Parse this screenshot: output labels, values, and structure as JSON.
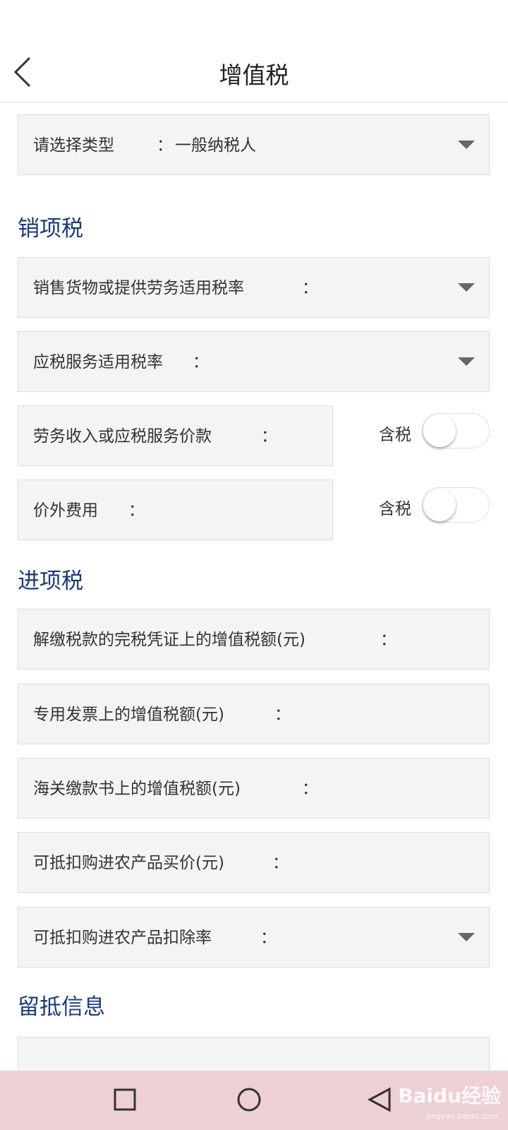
{
  "header": {
    "title": "增值税"
  },
  "type_select": {
    "label": "请选择类型",
    "colon": "：",
    "value": "一般纳税人"
  },
  "sections": {
    "output_tax": "销项税",
    "input_tax": "进项税",
    "retained": "留抵信息"
  },
  "output_fields": {
    "goods_rate": {
      "label": "销售货物或提供劳务适用税率",
      "colon": "："
    },
    "service_rate": {
      "label": "应税服务适用税率",
      "colon": "："
    },
    "service_income": {
      "label": "劳务收入或应税服务价款",
      "colon": "：",
      "toggle_label": "含税",
      "toggle_on": false
    },
    "extra_fee": {
      "label": "价外费用",
      "colon": "：",
      "toggle_label": "含税",
      "toggle_on": false
    }
  },
  "input_fields": {
    "certificate_tax": {
      "label": "解缴税款的完税凭证上的增值税额(元)",
      "colon": "："
    },
    "special_invoice": {
      "label": "专用发票上的增值税额(元)",
      "colon": "："
    },
    "customs": {
      "label": "海关缴款书上的增值税额(元)",
      "colon": "："
    },
    "farm_price": {
      "label": "可抵扣购进农产品买价(元)",
      "colon": "："
    },
    "farm_rate": {
      "label": "可抵扣购进农产品扣除率",
      "colon": "："
    }
  },
  "watermark": {
    "text": "Baidu经验",
    "sub": "jingyan.baidu.com"
  },
  "colors": {
    "section_title": "#1a3a7a",
    "field_bg": "#f4f4f4",
    "nav_bg": "#ecd0d4"
  }
}
